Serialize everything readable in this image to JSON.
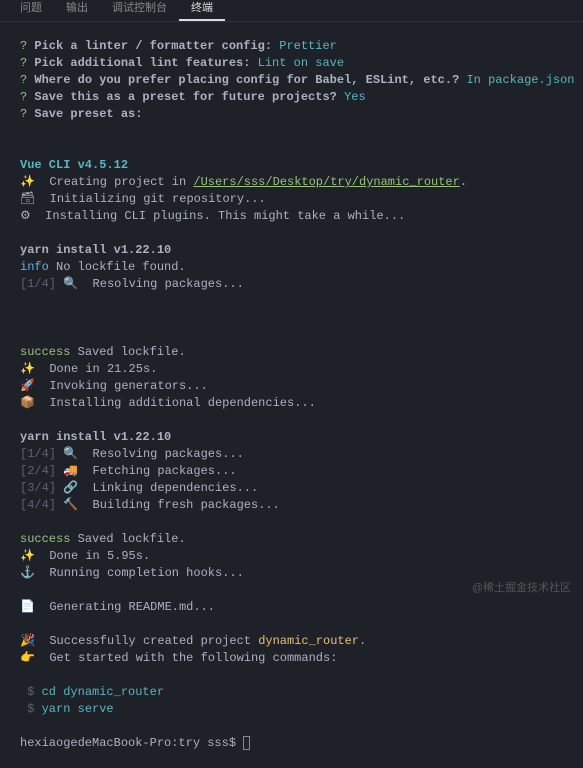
{
  "tabs": {
    "items": [
      {
        "label": "问题"
      },
      {
        "label": "输出"
      },
      {
        "label": "调试控制台"
      },
      {
        "label": "终端"
      }
    ],
    "activeIndex": 3
  },
  "prompts": {
    "q": "?",
    "p1": "Pick a linter / formatter config:",
    "a1": "Prettier",
    "p2": "Pick additional lint features:",
    "a2": "Lint on save",
    "p3": "Where do you prefer placing config for Babel, ESLint, etc.?",
    "a3": "In package.json",
    "p4": "Save this as a preset for future projects?",
    "a4": "Yes",
    "p5": "Save preset as:"
  },
  "cli": {
    "header": "Vue CLI v4.5.12",
    "creating_prefix": "✨  Creating project in ",
    "project_path": "/Users/sss/Desktop/try/dynamic_router",
    "dot": ".",
    "init_git": "🗃  Initializing git repository...",
    "install_plugins": "⚙  Installing CLI plugins. This might take a while..."
  },
  "yarn1": {
    "header": "yarn install v1.22.10",
    "info": "info",
    "info_msg": " No lockfile found.",
    "step1_num": "[1/4]",
    "step1_emoji": " 🔍 ",
    "step1_msg": " Resolving packages..."
  },
  "yarn2": {
    "success": "success",
    "saved": " Saved lockfile",
    "dot": ".",
    "done": "✨  Done in 21.25s.",
    "invoking": "🚀  Invoking generators...",
    "installing": "📦  Installing additional dependencies..."
  },
  "yarn3": {
    "header": "yarn install v1.22.10",
    "s1n": "[1/4]",
    "s1e": " 🔍 ",
    "s1m": " Resolving packages...",
    "s2n": "[2/4]",
    "s2e": " 🚚 ",
    "s2m": " Fetching packages...",
    "s3n": "[3/4]",
    "s3e": " 🔗 ",
    "s3m": " Linking dependencies...",
    "s4n": "[4/4]",
    "s4e": " 🔨 ",
    "s4m": " Building fresh packages..."
  },
  "final": {
    "success": "success",
    "saved": " Saved lockfile",
    "dot": ".",
    "done": "✨  Done in 5.95s.",
    "hooks": "⚓  Running completion hooks...",
    "readme": "📄  Generating README.md...",
    "created_prefix": "🎉  Successfully created project ",
    "project_name": "dynamic_router",
    "get_started": "👉  Get started with the following commands:"
  },
  "cmds": {
    "dollar": " $ ",
    "cd": "cd dynamic_router",
    "serve": "yarn serve"
  },
  "shell": {
    "prompt": "hexiaogedeMacBook-Pro:try sss$ "
  },
  "watermark": "@稀土掘金技术社区"
}
